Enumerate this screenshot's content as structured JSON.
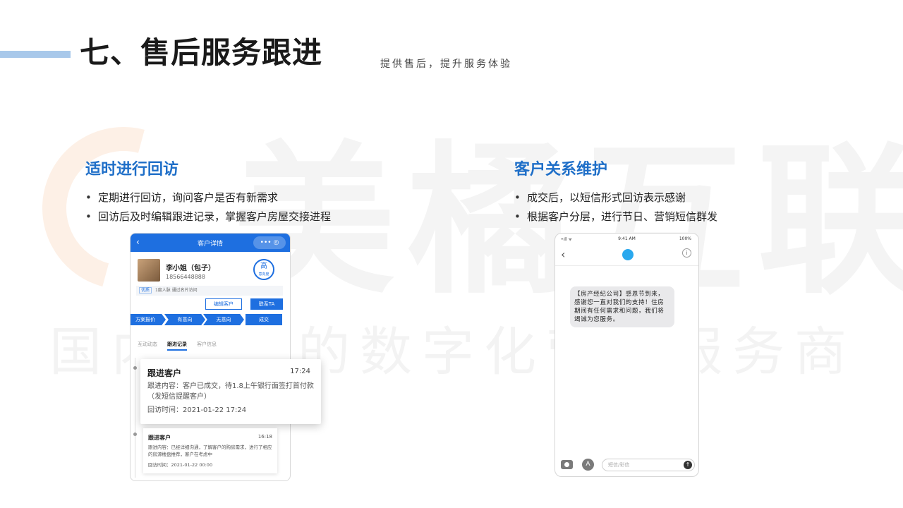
{
  "header": {
    "title": "七、售后服务跟进",
    "subtitle": "提供售后，提升服务体验"
  },
  "watermark": {
    "brand": "美橘互联",
    "tagline": "国内领先的数字化营销服务商"
  },
  "left_section": {
    "title": "适时进行回访",
    "bullets": [
      "定期进行回访，询问客户是否有新需求",
      "回访后及时编辑跟进记录，掌握客户房屋交接进程"
    ]
  },
  "right_section": {
    "title": "客户关系维护",
    "bullets": [
      "成交后，以短信形式回访表示感谢",
      "根据客户分层，进行节日、营销短信群发"
    ]
  },
  "crm_phone": {
    "nav_title": "客户详情",
    "caps": "•••  ◎",
    "customer_name": "李小姐（包子）",
    "customer_phone": "18566448888",
    "level": "高",
    "level_sub": "意向度",
    "tag": "优质",
    "tag_info": "1度人脉  通过名片访问",
    "edit_button": "编辑客户",
    "contact_button": "联系TA",
    "stages": [
      "方案报价",
      "有意向",
      "无意向",
      "成交"
    ],
    "tabs": [
      "互动动态",
      "跟进记录",
      "客户信息"
    ],
    "records": [
      {
        "title": "跟进客户",
        "time": "17:24",
        "content": "跟进内容：客户已成交，待1.8上午银行面签打首付款（发短信提醒客户）",
        "visit": "回访时间：2021-01-22 17:24"
      },
      {
        "title": "跟进客户",
        "time": "16:18",
        "content": "跟进内容：已经详细沟通，了解客户的购房需求，进行了相应的房源楼盘推荐，客户在考虑中",
        "visit": "回访时间：2021-01-22 00:00"
      }
    ]
  },
  "sms_phone": {
    "time": "9:41 AM",
    "battery": "100%",
    "signal": "•ıll ᯤ",
    "back": "‹",
    "info": "i",
    "message": "【房产经纪公司】感恩节到来，感谢您一直对我们的支持！住房期间有任何需求和问题，我们将竭诚为您服务。",
    "input_placeholder": "短信/彩信",
    "app_glyph": "A",
    "send_glyph": "↑"
  },
  "colors": {
    "accent_blue": "#1f6fc8",
    "crm_blue": "#1e6fe0",
    "accent_bar": "#a8c8ea"
  }
}
